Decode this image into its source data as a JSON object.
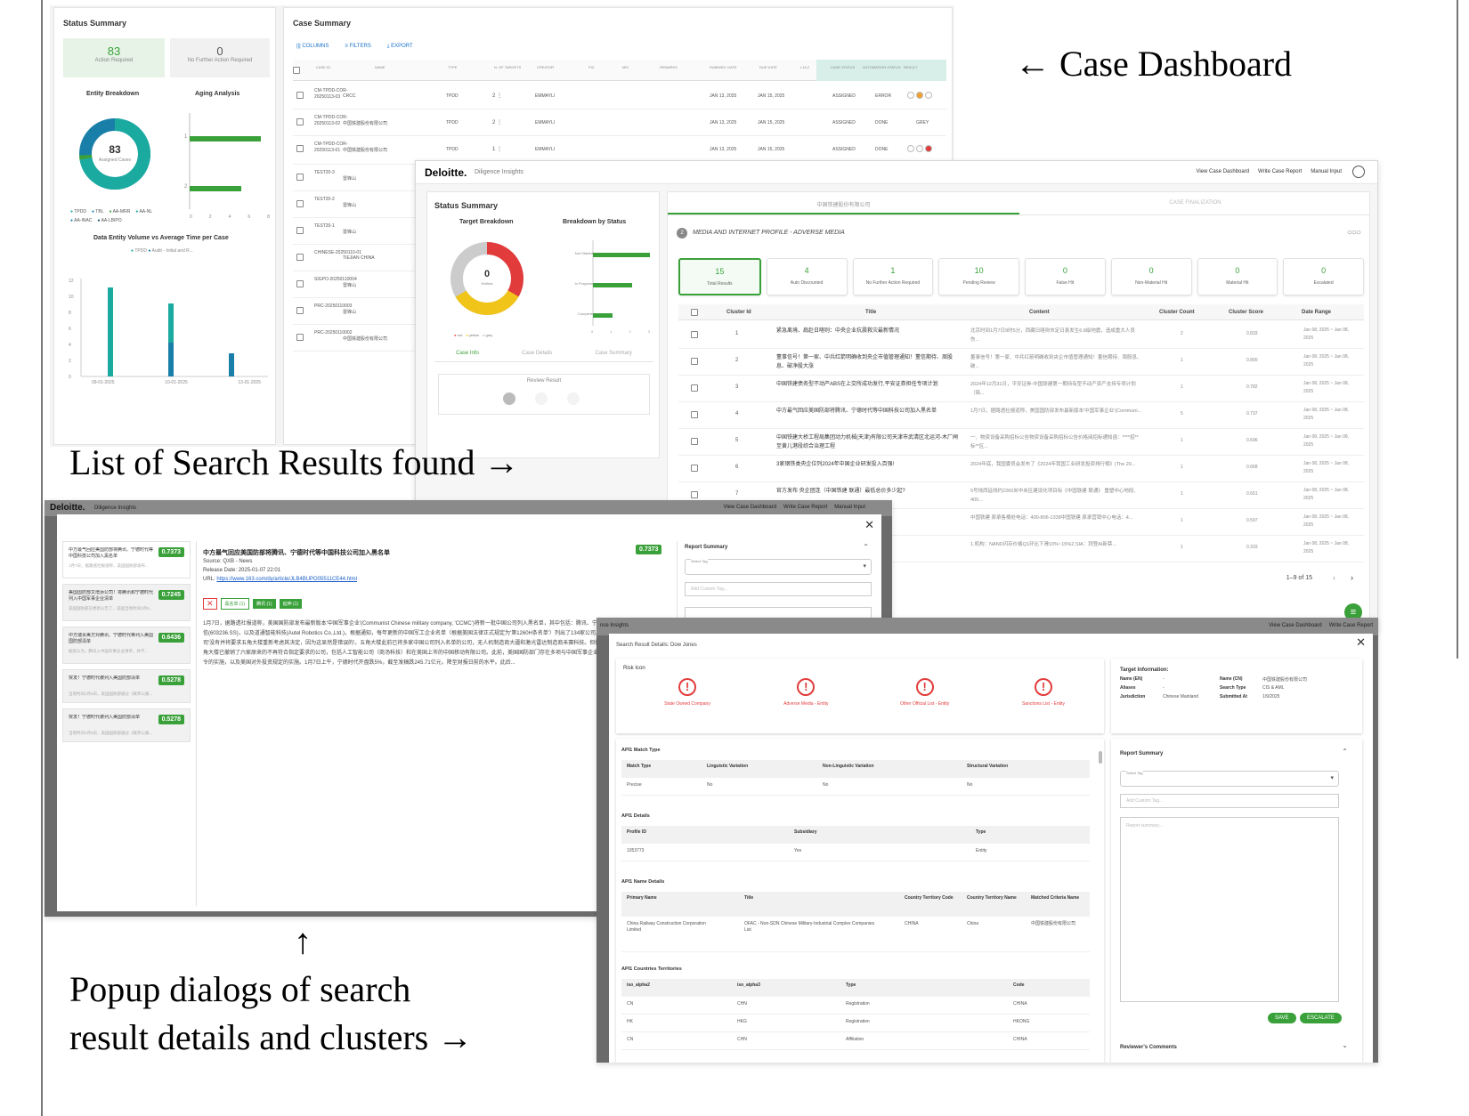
{
  "annotations": {
    "case_dashboard": "← Case Dashboard",
    "search_results": "List of Search Results found →",
    "popup_arrow": "↑",
    "popup_line1": "Popup dialogs of search",
    "popup_line2": "result details and clusters →"
  },
  "dashboard": {
    "status_summary_title": "Status Summary",
    "action_required_count": "83",
    "action_required_label": "Action Required",
    "no_further_count": "0",
    "no_further_label": "No Further Action Required",
    "entity_breakdown_title": "Entity Breakdown",
    "aging_analysis_title": "Aging Analysis",
    "donut_center": "83",
    "donut_sub": "Assigned Cases",
    "legend": [
      "TPDD",
      "TBL",
      "AA-MRR",
      "AA-NL",
      "AA-INAC",
      "AA-LBIPO"
    ],
    "aging_ticks_x": [
      "0",
      "2",
      "4",
      "6",
      "8"
    ],
    "aging_ticks_y": [
      "1",
      "2"
    ],
    "volume_title": "Data Entity Volume vs Average Time per Case",
    "volume_legend": [
      "TPDD",
      "Audit - Initial and R..."
    ],
    "volume_y_ticks": [
      "12",
      "10",
      "8",
      "6",
      "4",
      "2",
      "0"
    ],
    "volume_x_ticks": [
      "09-01-2025",
      "10-01-2025",
      "13-01-2025"
    ],
    "case_summary_title": "Case Summary",
    "toolbar": [
      "COLUMNS",
      "FILTERS",
      "EXPORT"
    ],
    "table_headers": [
      "CASE ID",
      "NAME",
      "TYPE",
      "N. OF TARGETS",
      "CREATOR",
      "PIC",
      "MIC",
      "REMARKS",
      "SUBMISS. DATE",
      "DUE DATE",
      "L1/L2",
      "CASE STATUS",
      "AUTOMATION STATUS",
      "RESULT"
    ],
    "rows": [
      {
        "id": "CM-TPDD-COR-20250113-03",
        "name": "CRCC",
        "type": "TPDD",
        "targets": "2",
        "creator": "EMMAYLI",
        "sub": "JAN 13, 2025",
        "due": "JAN 15, 2025",
        "status": "ASSIGNED",
        "auto": "ERROR",
        "result": ""
      },
      {
        "id": "CM-TPDD-COR-20250113-02",
        "name": "中国铁建股份有限公司",
        "type": "TPDD",
        "targets": "2",
        "creator": "EMMAYLI",
        "sub": "JAN 13, 2025",
        "due": "JAN 15, 2025",
        "status": "ASSIGNED",
        "auto": "DONE",
        "result": "GREY"
      },
      {
        "id": "CM-TPDD-COR-20250113-01",
        "name": "中国铁建股份有限公司",
        "type": "TPDD",
        "targets": "1",
        "creator": "EMMAYLI",
        "sub": "JAN 13, 2025",
        "due": "JAN 15, 2025",
        "status": "ASSIGNED",
        "auto": "DONE",
        "result": ""
      },
      {
        "id": "TEST20-3",
        "name": "雷锋山"
      },
      {
        "id": "TEST20-2",
        "name": "雷锋山"
      },
      {
        "id": "TEST20-1",
        "name": "雷锋山"
      },
      {
        "id": "CHINESE-20250110-01",
        "name": "TIEJIAN CHINA"
      },
      {
        "id": "SIGPO-20250110004",
        "name": "雷锋山"
      },
      {
        "id": "PRC-20250110003",
        "name": "雷锋山"
      },
      {
        "id": "PRC-20250110002",
        "name": "中国铁建股份有限公司"
      }
    ]
  },
  "insights": {
    "brand": "Deloitte.",
    "product": "Diligence Insights",
    "nav": [
      "View Case Dashboard",
      "Write Case Report",
      "Manual Input"
    ],
    "status_summary": "Status Summary",
    "target_breakdown": "Target Breakdown",
    "breakdown_by_status": "Breakdown by Status",
    "donut_center": "0",
    "donut_sub": "Entities",
    "status_labels": [
      "Not Started",
      "In Progress",
      "Complete"
    ],
    "bar_x_ticks": [
      "0",
      "1",
      "2",
      "3"
    ],
    "donut_legend": [
      "red",
      "yellow",
      "grey"
    ],
    "subtabs": [
      "Case Info",
      "Case Details",
      "Case Summary"
    ],
    "review_result": "Review Result",
    "tabs": [
      "中国铁建股份有限公司",
      "CASE FINALIZATION"
    ],
    "section_num": "2",
    "section_title": "MEDIA AND INTERNET PROFILE - ADVERSE MEDIA",
    "kpis": [
      {
        "n": "15",
        "l": "Total Results"
      },
      {
        "n": "4",
        "l": "Auto Discounted"
      },
      {
        "n": "1",
        "l": "No Further Action Required"
      },
      {
        "n": "10",
        "l": "Pending Review"
      },
      {
        "n": "0",
        "l": "False Hit"
      },
      {
        "n": "0",
        "l": "Non-Material Hit"
      },
      {
        "n": "0",
        "l": "Material Hit"
      },
      {
        "n": "0",
        "l": "Escalated"
      }
    ],
    "cols": [
      "Cluster Id",
      "Title",
      "Content",
      "Cluster Count",
      "Cluster Score",
      "Date Range"
    ],
    "rows": [
      {
        "id": "1",
        "title": "紧急离境、肩赴日喀则：中央企业抗震救灾最新情况",
        "content": "北京时间1月7日9时5分，西藏日喀则市定日县发生6.8级地震，造成重大人员伤...",
        "count": "2",
        "score": "0.833",
        "date": "Jan 08, 2025 ~ Jan 08, 2025"
      },
      {
        "id": "2",
        "title": "董事信号！第一家、中兵红箭明确收到央企市值管理通知！董信期待、周股息、破净股大涨",
        "content": "董事信号！第一家、中兵红箭明确收到央企市值管理通知！董信期待、周股息、破...",
        "count": "1",
        "score": "0.800",
        "date": "Jan 08, 2025 ~ Jan 08, 2025"
      },
      {
        "id": "3",
        "title": "中国铁建债务型不动产ABS在上交所成功发行,平安证券担任专项计划",
        "content": "2024年12月31日，平安证券-中国铁建第一期持有型不动产资产支持专项计划（简...",
        "count": "1",
        "score": "0.782",
        "date": "Jan 08, 2025 ~ Jan 08, 2025"
      },
      {
        "id": "4",
        "title": "中方最气回应美国防部将腾讯、宁德时代等中国科技公司加入黑名单",
        "content": "1月7日，据路透社报道称，美国国防部发布最新版本'中国军事企业'(Communi...",
        "count": "5",
        "score": "0.737",
        "date": "Jan 08, 2025 ~ Jan 08, 2025"
      },
      {
        "id": "5",
        "title": "中国铁建大桥工程局集团动力机械(天津)有限公司天津市武清区北运河-木厂闸至黄儿港段综合治理工程",
        "content": "一、物资设备采购招标公告物资设备采购招标公告价格阅招标通知函：****招**标**区...",
        "count": "1",
        "score": "0.696",
        "date": "Jan 08, 2025 ~ Jan 08, 2025"
      },
      {
        "id": "6",
        "title": "3家钢铁类央企位列2024年中国企业研发投入百强!",
        "content": "2024年底，我国委员会发布了《2024年我国工业研发投资排行榜》(The 20...",
        "count": "1",
        "score": "0.668",
        "date": "Jan 08, 2025 ~ Jan 08, 2025"
      },
      {
        "id": "7",
        "title": "官方发布 央企团连（中国铁建 联通）最低总价多少起?",
        "content": "5号线西延线约2260米中央区建设化项目标《中国铁建 联通》 重塑中心地段、400...",
        "count": "1",
        "score": "0.651",
        "date": "Jan 08, 2025 ~ Jan 08, 2025"
      },
      {
        "id": "8",
        "title": "中国铁建 原承·上海",
        "content": "中国铁建 原承售楼处电话：400-806-1338中国铁建 原承营销中心电话：4...",
        "count": "1",
        "score": "0.597",
        "date": "Jan 08, 2025 ~ Jan 08, 2025"
      },
      {
        "id": "9",
        "title": "A拜登A新禁令前产",
        "content": "1.机构：NAND闪存价格Q1环比下滑10%~15%2.SIA：拜登AI新禁...",
        "count": "1",
        "score": "0.333",
        "date": "Jan 08, 2025 ~ Jan 08, 2025"
      }
    ],
    "pagination": "1–9 of 15"
  },
  "article_popup": {
    "brand": "Deloitte.",
    "product": "Diligence Insights",
    "nav": [
      "View Case Dashboard",
      "Write Case Report",
      "Manual Input"
    ],
    "list": [
      {
        "title": "中方最气回应美国防部将腾讯、宁德时代等中国科技公司加入黑名单",
        "score": "0.7373",
        "snippet": "1月7日，据路透社报道称，美国国防部发布..."
      },
      {
        "title": "美国国防部又增添公司！将腾讯和宁德时代列入中国军事企业清单",
        "score": "0.7245",
        "snippet": "美国国防部已更新公告了，美国当地时间1月6..."
      },
      {
        "title": "中方谴责美方对腾讯、宁德时代等列入美国国防部清单",
        "score": "0.6436",
        "snippet": "据悉认为，腾讯入中国军事企业清单，并不..."
      },
      {
        "title": "突发！宁德时代被列入美国防部清单",
        "score": "0.5278",
        "snippet": "当地时间1月6日，美国国防部通过《联邦公报..."
      },
      {
        "title": "突发！宁德时代被列入美国防部清单",
        "score": "0.5278",
        "snippet": "当地时间1月6日，美国国防部通过《联邦公报..."
      }
    ],
    "title": "中方最气回应美国防部将腾讯、宁德时代等中国科技公司加入黑名单",
    "score": "0.7373",
    "source": "Source: QXB - News",
    "release": "Release Date: 2025-01-07 22:01",
    "url_label": "URL:",
    "url": "https://www.163.com/dy/article/JLB4BUPO05511CE44.html",
    "tags": [
      "黑名单 (1)",
      "腾讯 (1)",
      "延伸 (1)"
    ],
    "body": "1月7日，据路透社报道称，美国国防部发布最新版本'中国军事企业'(Communist Chinese military company, 'CCMC')将新一批中国公司列入黑名单，其中包括：腾讯、宁德时代、禾赛科技、移远通信(603236.SS)，以及道通智能科技(Autel Robotics Co.,Ltd.)，根据通知，每年更新的中国军工企业名单（根据美国法律正式规定为'第1260H条名单'）列出了134家公司。移远通信对此回应称，该公司'没有并将要求五角大楼重新考虑其决定，因为这显然是错误的'。五角大楼此前已将多家中国公司列入名单的公司，无人机制造商大疆和激光雷达制造商禾赛科技。但仍然将他们的名单上。美国五角大楼已撤销了六家原来的不再符合指定要求的公司，包括人工智能公司（商汤科技）和在美国上市的中国移动有限公司。此前，美国国防部门存在多项与中国军事企业相关的审查。另一些行政命令的实施，以及美国对外投资规定的实施。1月7日上午，宁德时代开盘跌5%，截至发稿跌245.71亿元，降至财报日前的水平。此后...",
    "report_summary": "Report Summary",
    "select_tag": "Select Tag",
    "add_custom_tag": "Add Custom Tag..."
  },
  "cluster_popup": {
    "header_partial": "nce Insights",
    "nav": [
      "View Case Dashboard",
      "Write Case Report"
    ],
    "search_result_details": "Search Result Details: Dow Jones",
    "risk_icon_label": "Risk Icon",
    "risk_icons": [
      "State Owned Company",
      "Adverse Media - Entity",
      "Other Official List - Entity",
      "Sanctions List - Entity"
    ],
    "target_info_title": "Target Information:",
    "target_info": [
      {
        "k": "Name (EN)",
        "v": "-"
      },
      {
        "k": "Aliases",
        "v": "-"
      },
      {
        "k": "Jurisdiction",
        "v": "Chinese Mainland"
      },
      {
        "k": "Name (CN)",
        "v": "中国铁建股份有限公司"
      },
      {
        "k": "Search Type",
        "v": "CIS & AML"
      },
      {
        "k": "Submitted At",
        "v": "1/9/2025"
      }
    ],
    "match_type_title": "API1 Match Type",
    "match_headers": [
      "Match Type",
      "Linguistic Variation",
      "Non-Linguistic Variation",
      "Structural Variation"
    ],
    "match_values": [
      "Precise",
      "No",
      "No",
      "No"
    ],
    "details_title": "API1 Details",
    "details_headers": [
      "Profile ID",
      "Subsidiary",
      "Type"
    ],
    "details_values": [
      "1053773",
      "Yes",
      "Entity"
    ],
    "name_title": "API1 Name Details",
    "name_headers": [
      "Primary Name",
      "Title",
      "Country Territory Code",
      "Country Territory Name",
      "Matched Criteria Name"
    ],
    "name_values": [
      "China Railway Construction Corporation Limited",
      "OFAC - Non-SDN Chinese Military-Industrial Complex Companies List",
      "CHINA",
      "China",
      "中国铁建股份有限公司"
    ],
    "countries_title": "API1 Countries Territories",
    "countries_headers": [
      "iso_alpha2",
      "iso_alpha3",
      "Type",
      "Code"
    ],
    "countries_rows": [
      [
        "CN",
        "CHN",
        "Registration",
        "CHINA"
      ],
      [
        "HK",
        "HKG",
        "Registration",
        "HKONG"
      ],
      [
        "CN",
        "CHN",
        "Affiliation",
        "CHINA"
      ]
    ],
    "report_summary": "Report Summary",
    "select_tag": "Select Tag",
    "add_custom_tag": "Add Custom Tag...",
    "report_placeholder": "Report summary...",
    "save": "SAVE",
    "escalate": "ESCALATE",
    "reviewers_comments": "Reviewer's Comments"
  },
  "colors": {
    "teal": "#1aaaa0",
    "blue": "#1a7fa8",
    "green": "#3aa13a",
    "red": "#e23b3b",
    "yellow": "#f0c419"
  }
}
